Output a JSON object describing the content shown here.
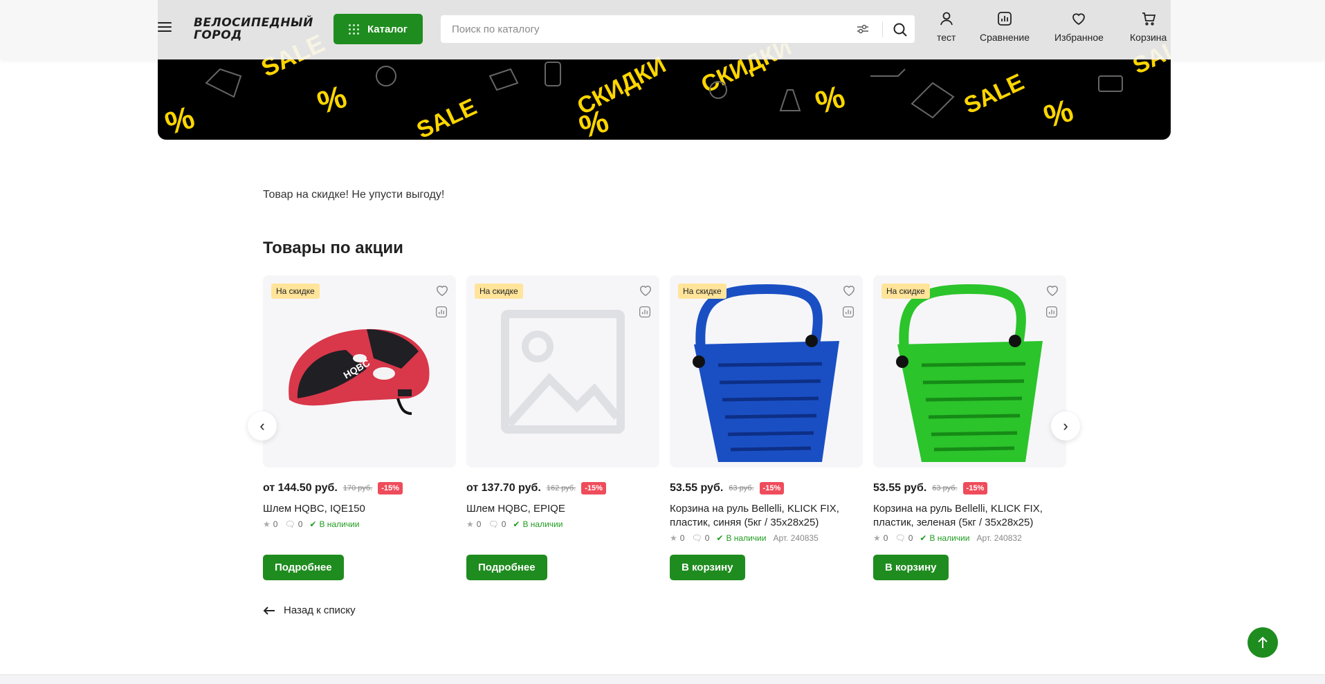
{
  "header": {
    "logo_line1": "ВЕЛОСИПЕДНЫЙ",
    "logo_line2": "ГОРОД",
    "catalog_label": "Каталог",
    "search_placeholder": "Поиск по каталогу",
    "nav": [
      {
        "label": "тест",
        "icon": "user-icon"
      },
      {
        "label": "Сравнение",
        "icon": "compare-icon"
      },
      {
        "label": "Избранное",
        "icon": "heart-icon"
      },
      {
        "label": "Корзина",
        "icon": "cart-icon"
      }
    ]
  },
  "banner": {
    "words": [
      "SALE",
      "СКИДКИ",
      "%"
    ],
    "text_color": "#ffd600"
  },
  "main": {
    "promo_text": "Товар на скидке! Не упусти выгоду!",
    "section_title": "Товары по акции",
    "products": [
      {
        "badge": "На скидке",
        "price": "от 144.50 руб.",
        "old_price": "170 руб.",
        "discount": "-15%",
        "name": "Шлем HQBC, IQE150",
        "rating": "0",
        "comments": "0",
        "stock": "В наличии",
        "article": "",
        "button": "Подробнее",
        "image": "helmet"
      },
      {
        "badge": "На скидке",
        "price": "от 137.70 руб.",
        "old_price": "162 руб.",
        "discount": "-15%",
        "name": "Шлем HQBC, EPIQE",
        "rating": "0",
        "comments": "0",
        "stock": "В наличии",
        "article": "",
        "button": "Подробнее",
        "image": "placeholder"
      },
      {
        "badge": "На скидке",
        "price": "53.55 руб.",
        "old_price": "63 руб.",
        "discount": "-15%",
        "name": "Корзина на руль Bellelli, KLICK FIX, пластик, синяя (5кг / 35x28x25)",
        "rating": "0",
        "comments": "0",
        "stock": "В наличии",
        "article": "Арт. 240835",
        "button": "В корзину",
        "image": "basket-blue"
      },
      {
        "badge": "На скидке",
        "price": "53.55 руб.",
        "old_price": "63 руб.",
        "discount": "-15%",
        "name": "Корзина на руль Bellelli, KLICK FIX, пластик, зеленая (5кг / 35x28x25)",
        "rating": "0",
        "comments": "0",
        "stock": "В наличии",
        "article": "Арт. 240832",
        "button": "В корзину",
        "image": "basket-green"
      }
    ],
    "prev_arrow": "‹",
    "next_arrow": "›",
    "back_label": "Назад к списку"
  },
  "colors": {
    "accent": "#1f8c1f",
    "badge": "#ffe49a",
    "discount": "#ef4c5b",
    "stock": "#1f9c1f",
    "basket_blue": "#1a4fc4",
    "basket_green": "#2bc42b"
  }
}
